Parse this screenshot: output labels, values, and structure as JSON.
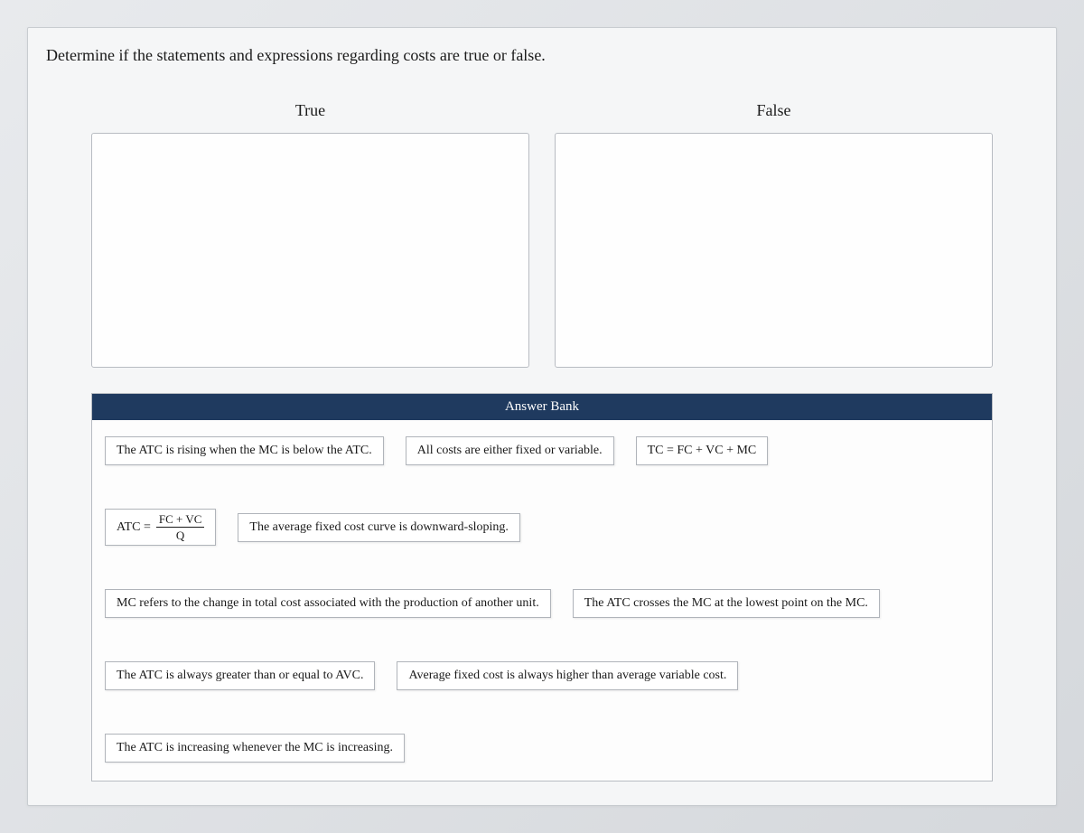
{
  "prompt": "Determine if the statements and expressions regarding costs are true or false.",
  "zones": {
    "true_label": "True",
    "false_label": "False"
  },
  "answer_bank": {
    "header": "Answer Bank",
    "items": [
      "The ATC is rising when the MC is below the ATC.",
      "All costs are either fixed or variable.",
      "TC = FC + VC + MC",
      "The average fixed cost curve is downward-sloping.",
      "MC refers to the change in total cost associated with the production of another unit.",
      "The ATC crosses the MC at the lowest point on the MC.",
      "The ATC is always greater than or equal to AVC.",
      "Average fixed cost is always higher than average variable cost.",
      "The ATC is increasing whenever the MC is increasing."
    ],
    "formula_item": {
      "lhs": "ATC =",
      "numerator": "FC + VC",
      "denominator": "Q"
    }
  }
}
